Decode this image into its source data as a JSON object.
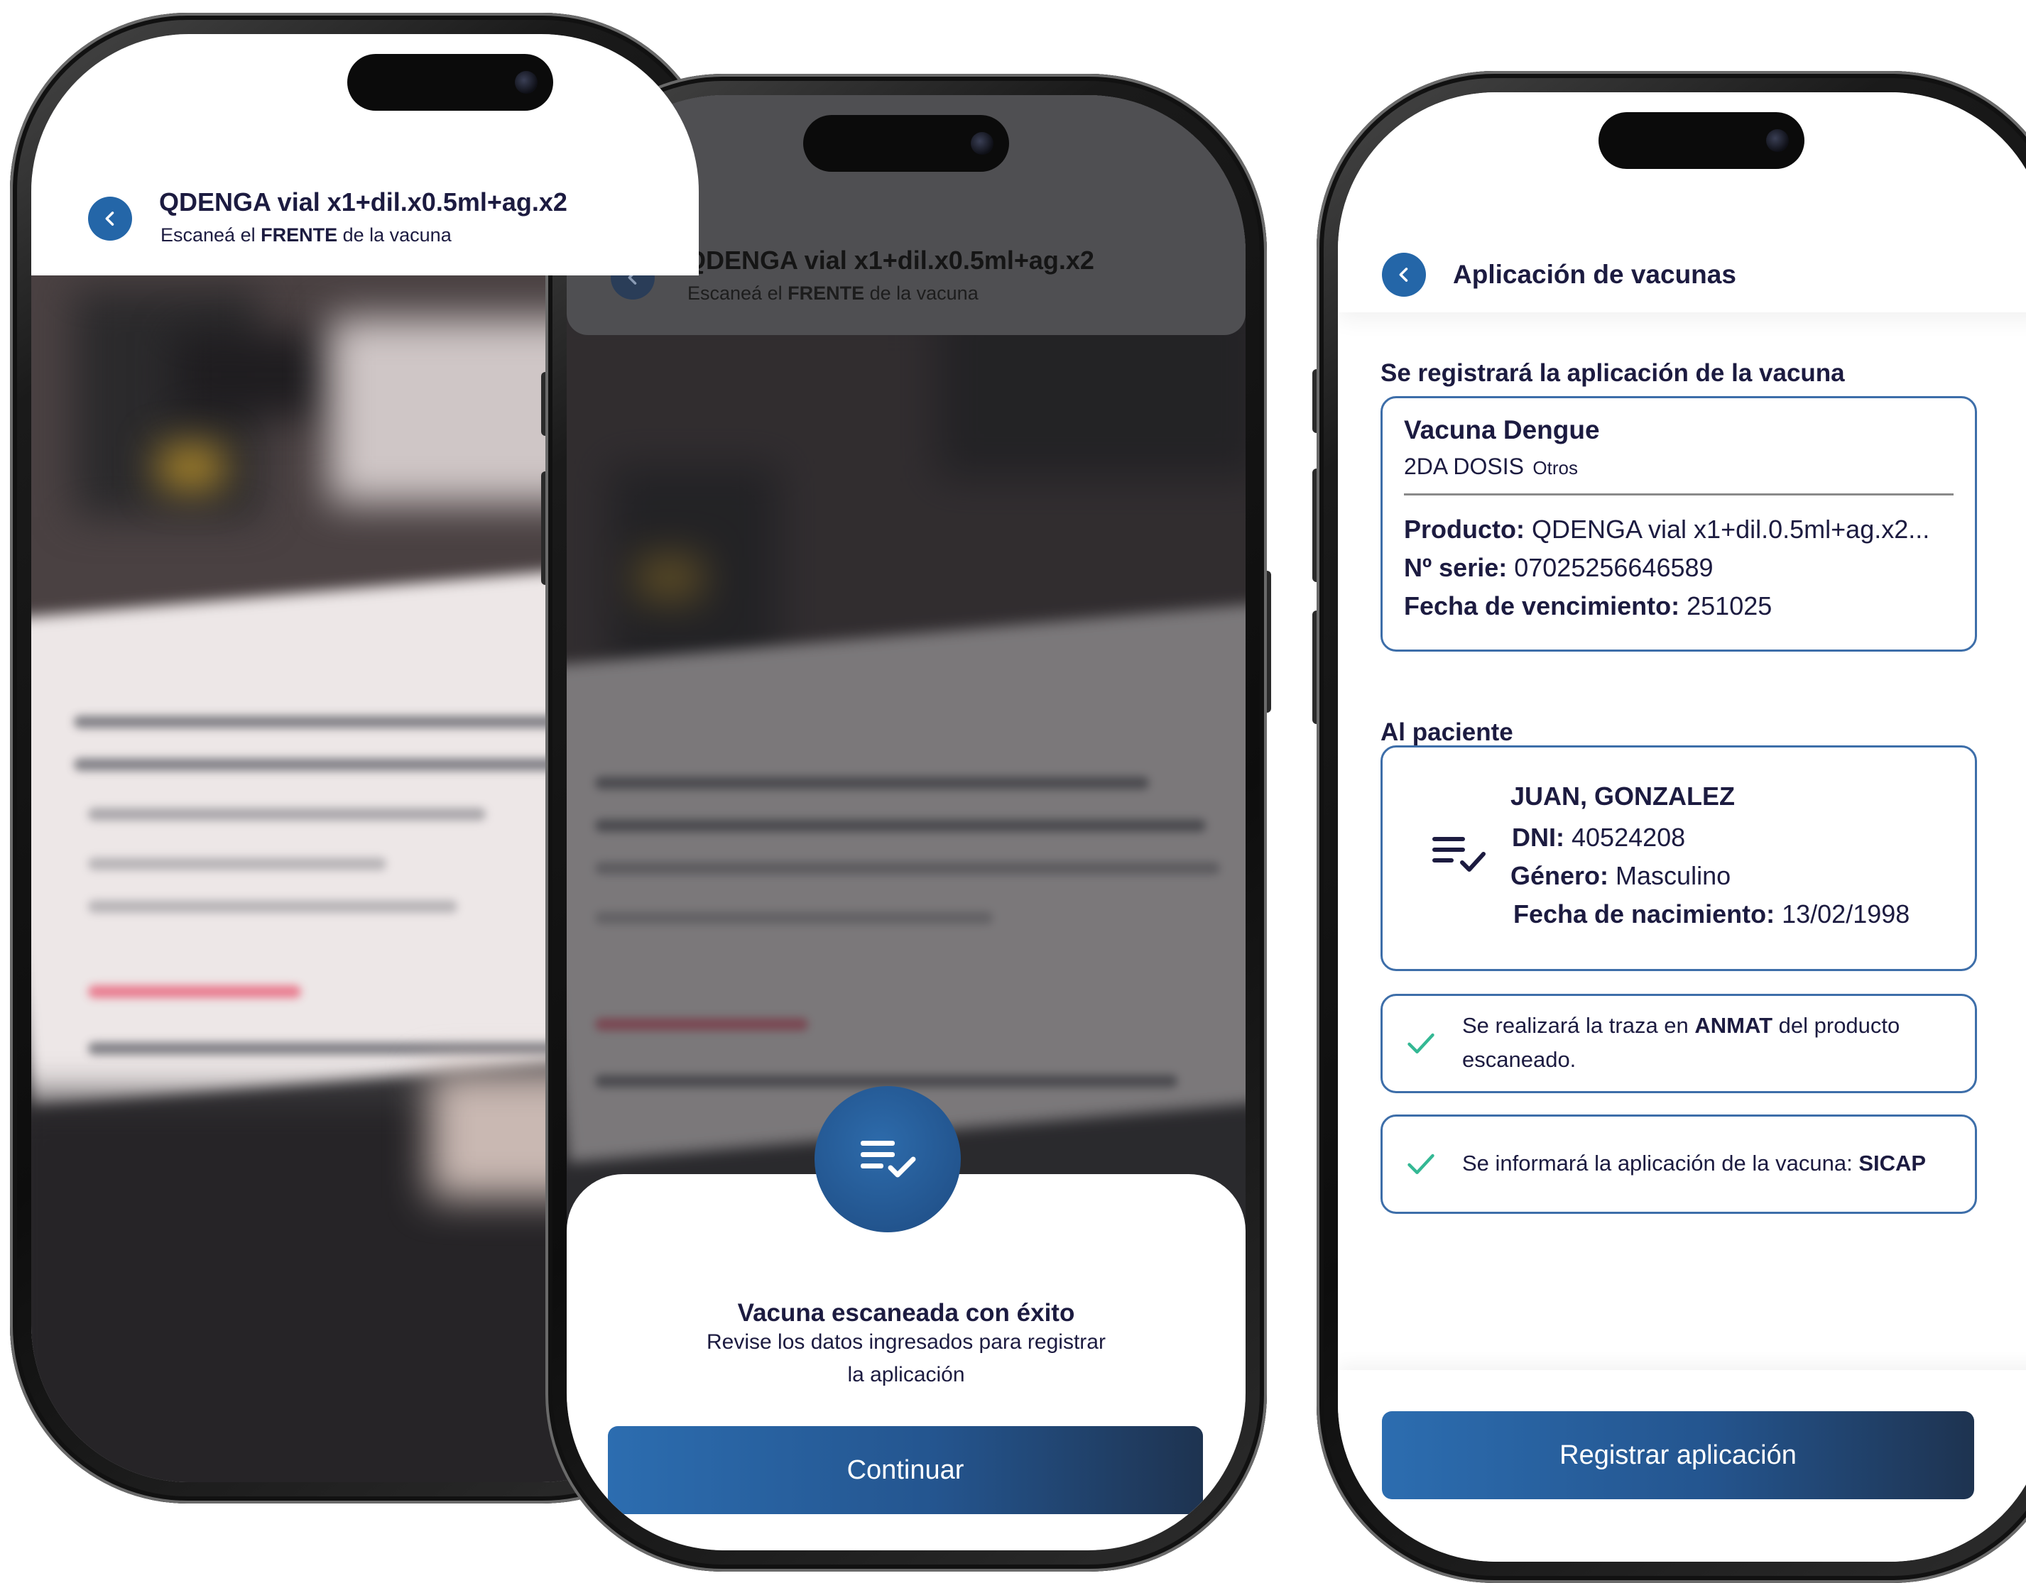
{
  "scan_screen": {
    "title": "QDENGA vial x1+dil.x0.5ml+ag.x2",
    "subtitle_prefix": "Escaneá el ",
    "subtitle_bold": "FRENTE",
    "subtitle_suffix": " de la vacuna"
  },
  "success_sheet": {
    "title": "Vacuna escaneada con éxito",
    "line1": "Revise los datos ingresados para registrar",
    "line2": "la aplicación",
    "continue_label": "Continuar"
  },
  "confirm_screen": {
    "header_title": "Aplicación de vacunas",
    "section_vaccine": "Se registrará la aplicación de la vacuna",
    "vaccine": {
      "name": "Vacuna Dengue",
      "dose": "2DA DOSIS",
      "dose_tag": "Otros",
      "product_label": "Producto:",
      "product_value": "QDENGA vial x1+dil.0.5ml+ag.x2...",
      "serial_label": "Nº serie:",
      "serial_value": "07025256646589",
      "expiry_label": "Fecha de vencimiento:",
      "expiry_value": "251025"
    },
    "section_patient": "Al paciente",
    "patient": {
      "name": "JUAN, GONZALEZ",
      "dni_label": "DNI:",
      "dni_value": "40524208",
      "gender_label": "Género:",
      "gender_value": "Masculino",
      "birth_label": "Fecha de nacimiento:",
      "birth_value": "13/02/1998"
    },
    "notice_anmat": {
      "prefix": "Se realizará la traza en ",
      "bold": "ANMAT",
      "suffix": " del producto",
      "line2": "escaneado."
    },
    "notice_sicap": {
      "prefix": "Se informará la aplicación de la vacuna: ",
      "bold": "SICAP"
    },
    "register_label": "Registrar aplicación"
  },
  "colors": {
    "primary": "#2466a8",
    "text_dark": "#1c1b40",
    "check_green": "#34b894",
    "card_border": "#3d6ea9"
  },
  "icons": {
    "back": "chevron-left-icon",
    "list_check": "list-check-icon",
    "check": "check-icon"
  }
}
